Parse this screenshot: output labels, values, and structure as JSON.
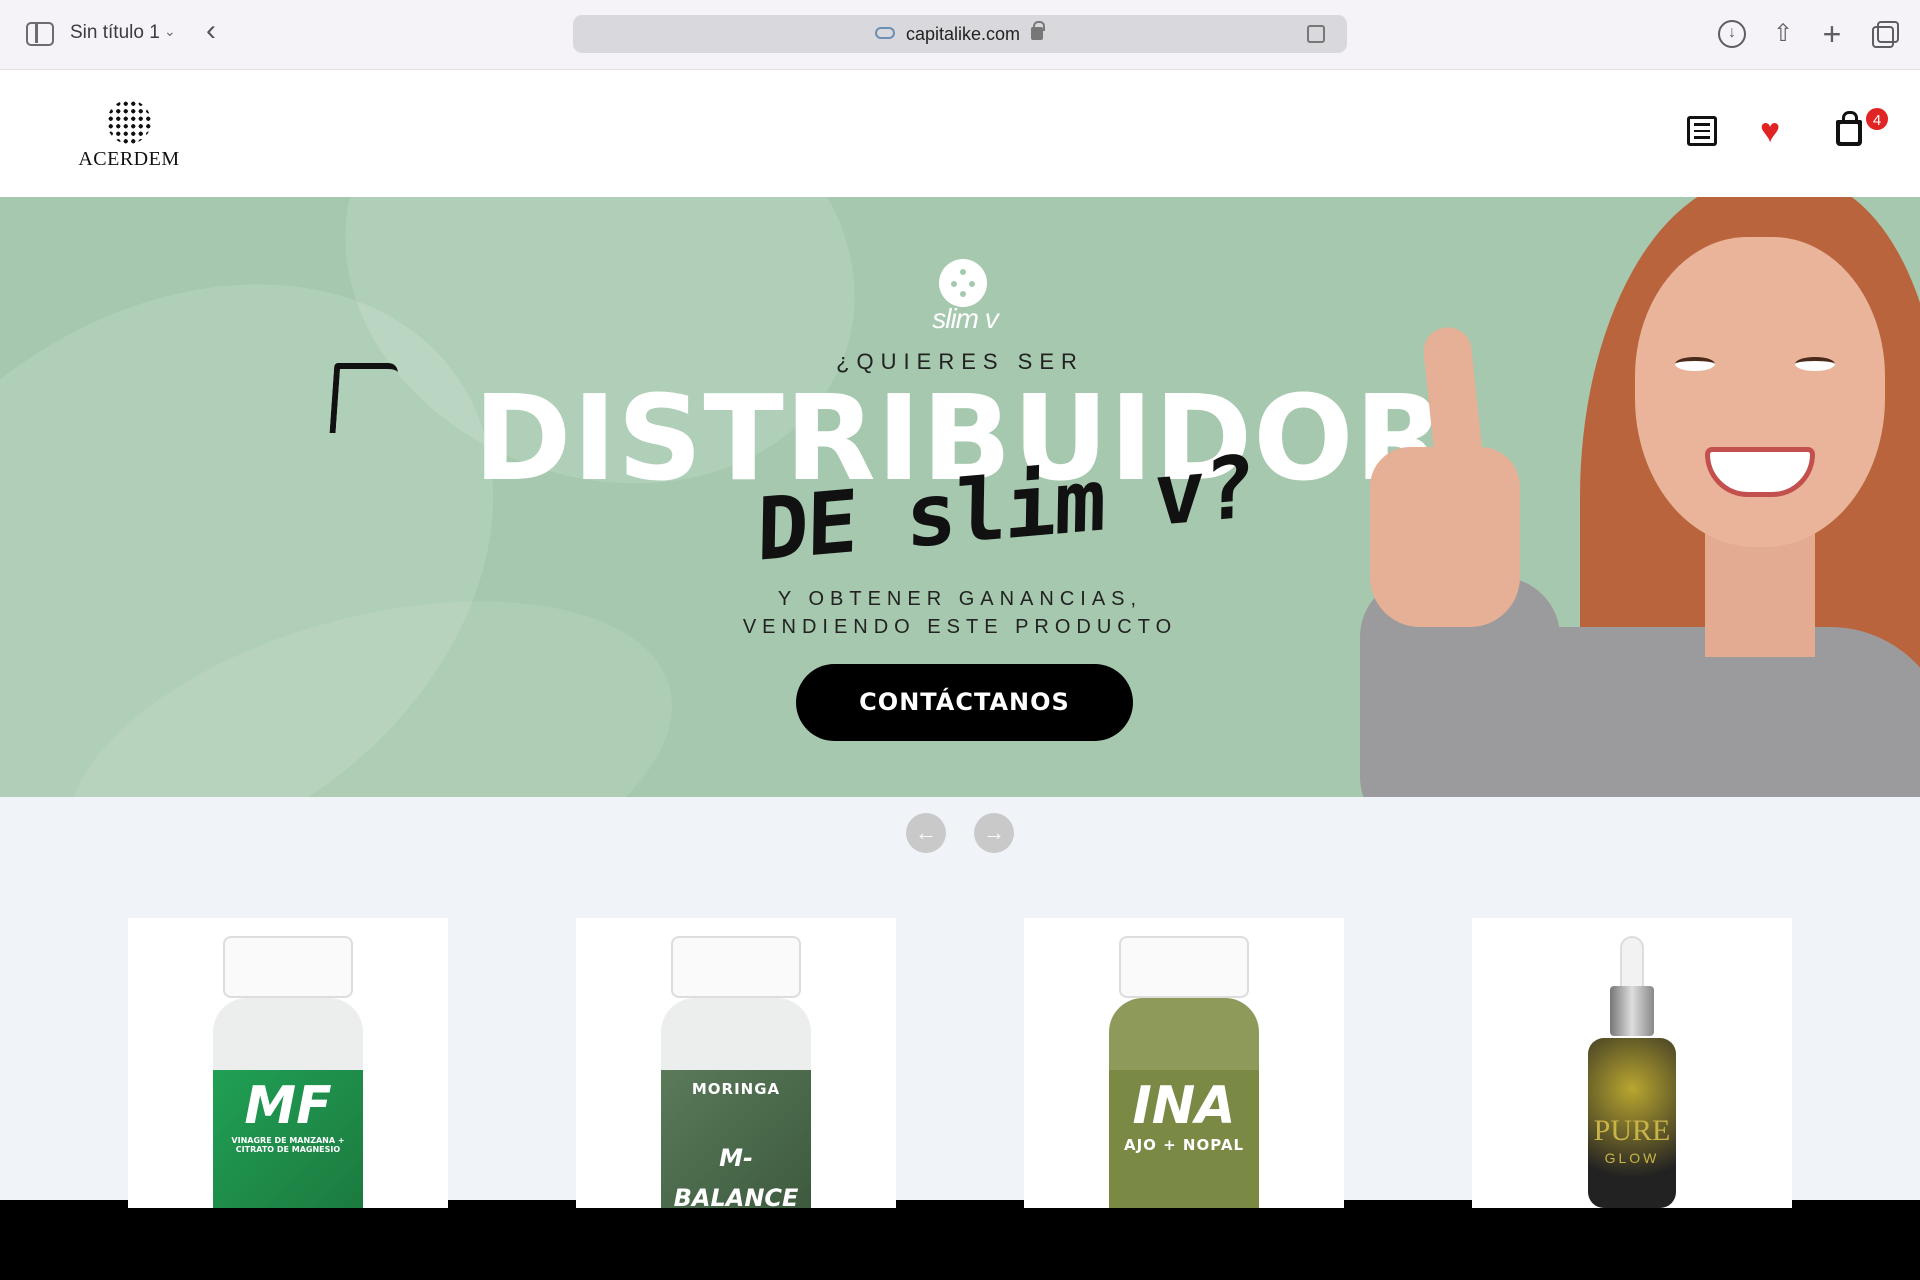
{
  "browser": {
    "tab_title": "Sin título 1",
    "url": "capitalike.com"
  },
  "header": {
    "logo_text": "ACERDEM",
    "cart_count": "4"
  },
  "hero": {
    "brand": "slim v",
    "kicker": "¿QUIERES SER",
    "headline": "DISTRIBUIDOR",
    "handwritten": "DE slim v?",
    "subline_1": "Y OBTENER GANANCIAS,",
    "subline_2": "VENDIENDO ESTE PRODUCTO",
    "cta_label": "CONTÁCTANOS"
  },
  "carousel": {
    "prev_icon": "arrow-left-icon",
    "next_icon": "arrow-right-icon"
  },
  "products": [
    {
      "label": "MF",
      "sub": "VINAGRE DE MANZANA + CITRATO DE MAGNESIO"
    },
    {
      "label": "M-BALANCE",
      "sub": "MORINGA"
    },
    {
      "label": "INA",
      "sub": "AJO + NOPAL"
    },
    {
      "label": "PURE",
      "sub": "GLOW"
    }
  ],
  "colors": {
    "hero_bg": "#a5c8ae",
    "accent_red": "#e02424",
    "cta_bg": "#000000"
  }
}
